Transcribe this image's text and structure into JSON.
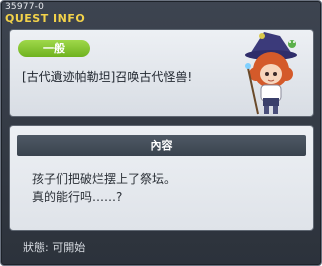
{
  "window": {
    "quest_id": "35977-0",
    "title": "QUEST INFO"
  },
  "quest": {
    "category": "一般",
    "name": "[古代遺迹帕勒坦]召唤古代怪兽!"
  },
  "content": {
    "header": "內容",
    "lines": [
      "孩子们把破烂摆上了祭坛。",
      "真的能行吗……?"
    ]
  },
  "status": {
    "text": "狀態:  可開始"
  },
  "colors": {
    "title": "#f2d24a",
    "badge": "#7fc22b",
    "panel_bg": "#e4e8ed",
    "window_bg": "#343a44"
  }
}
